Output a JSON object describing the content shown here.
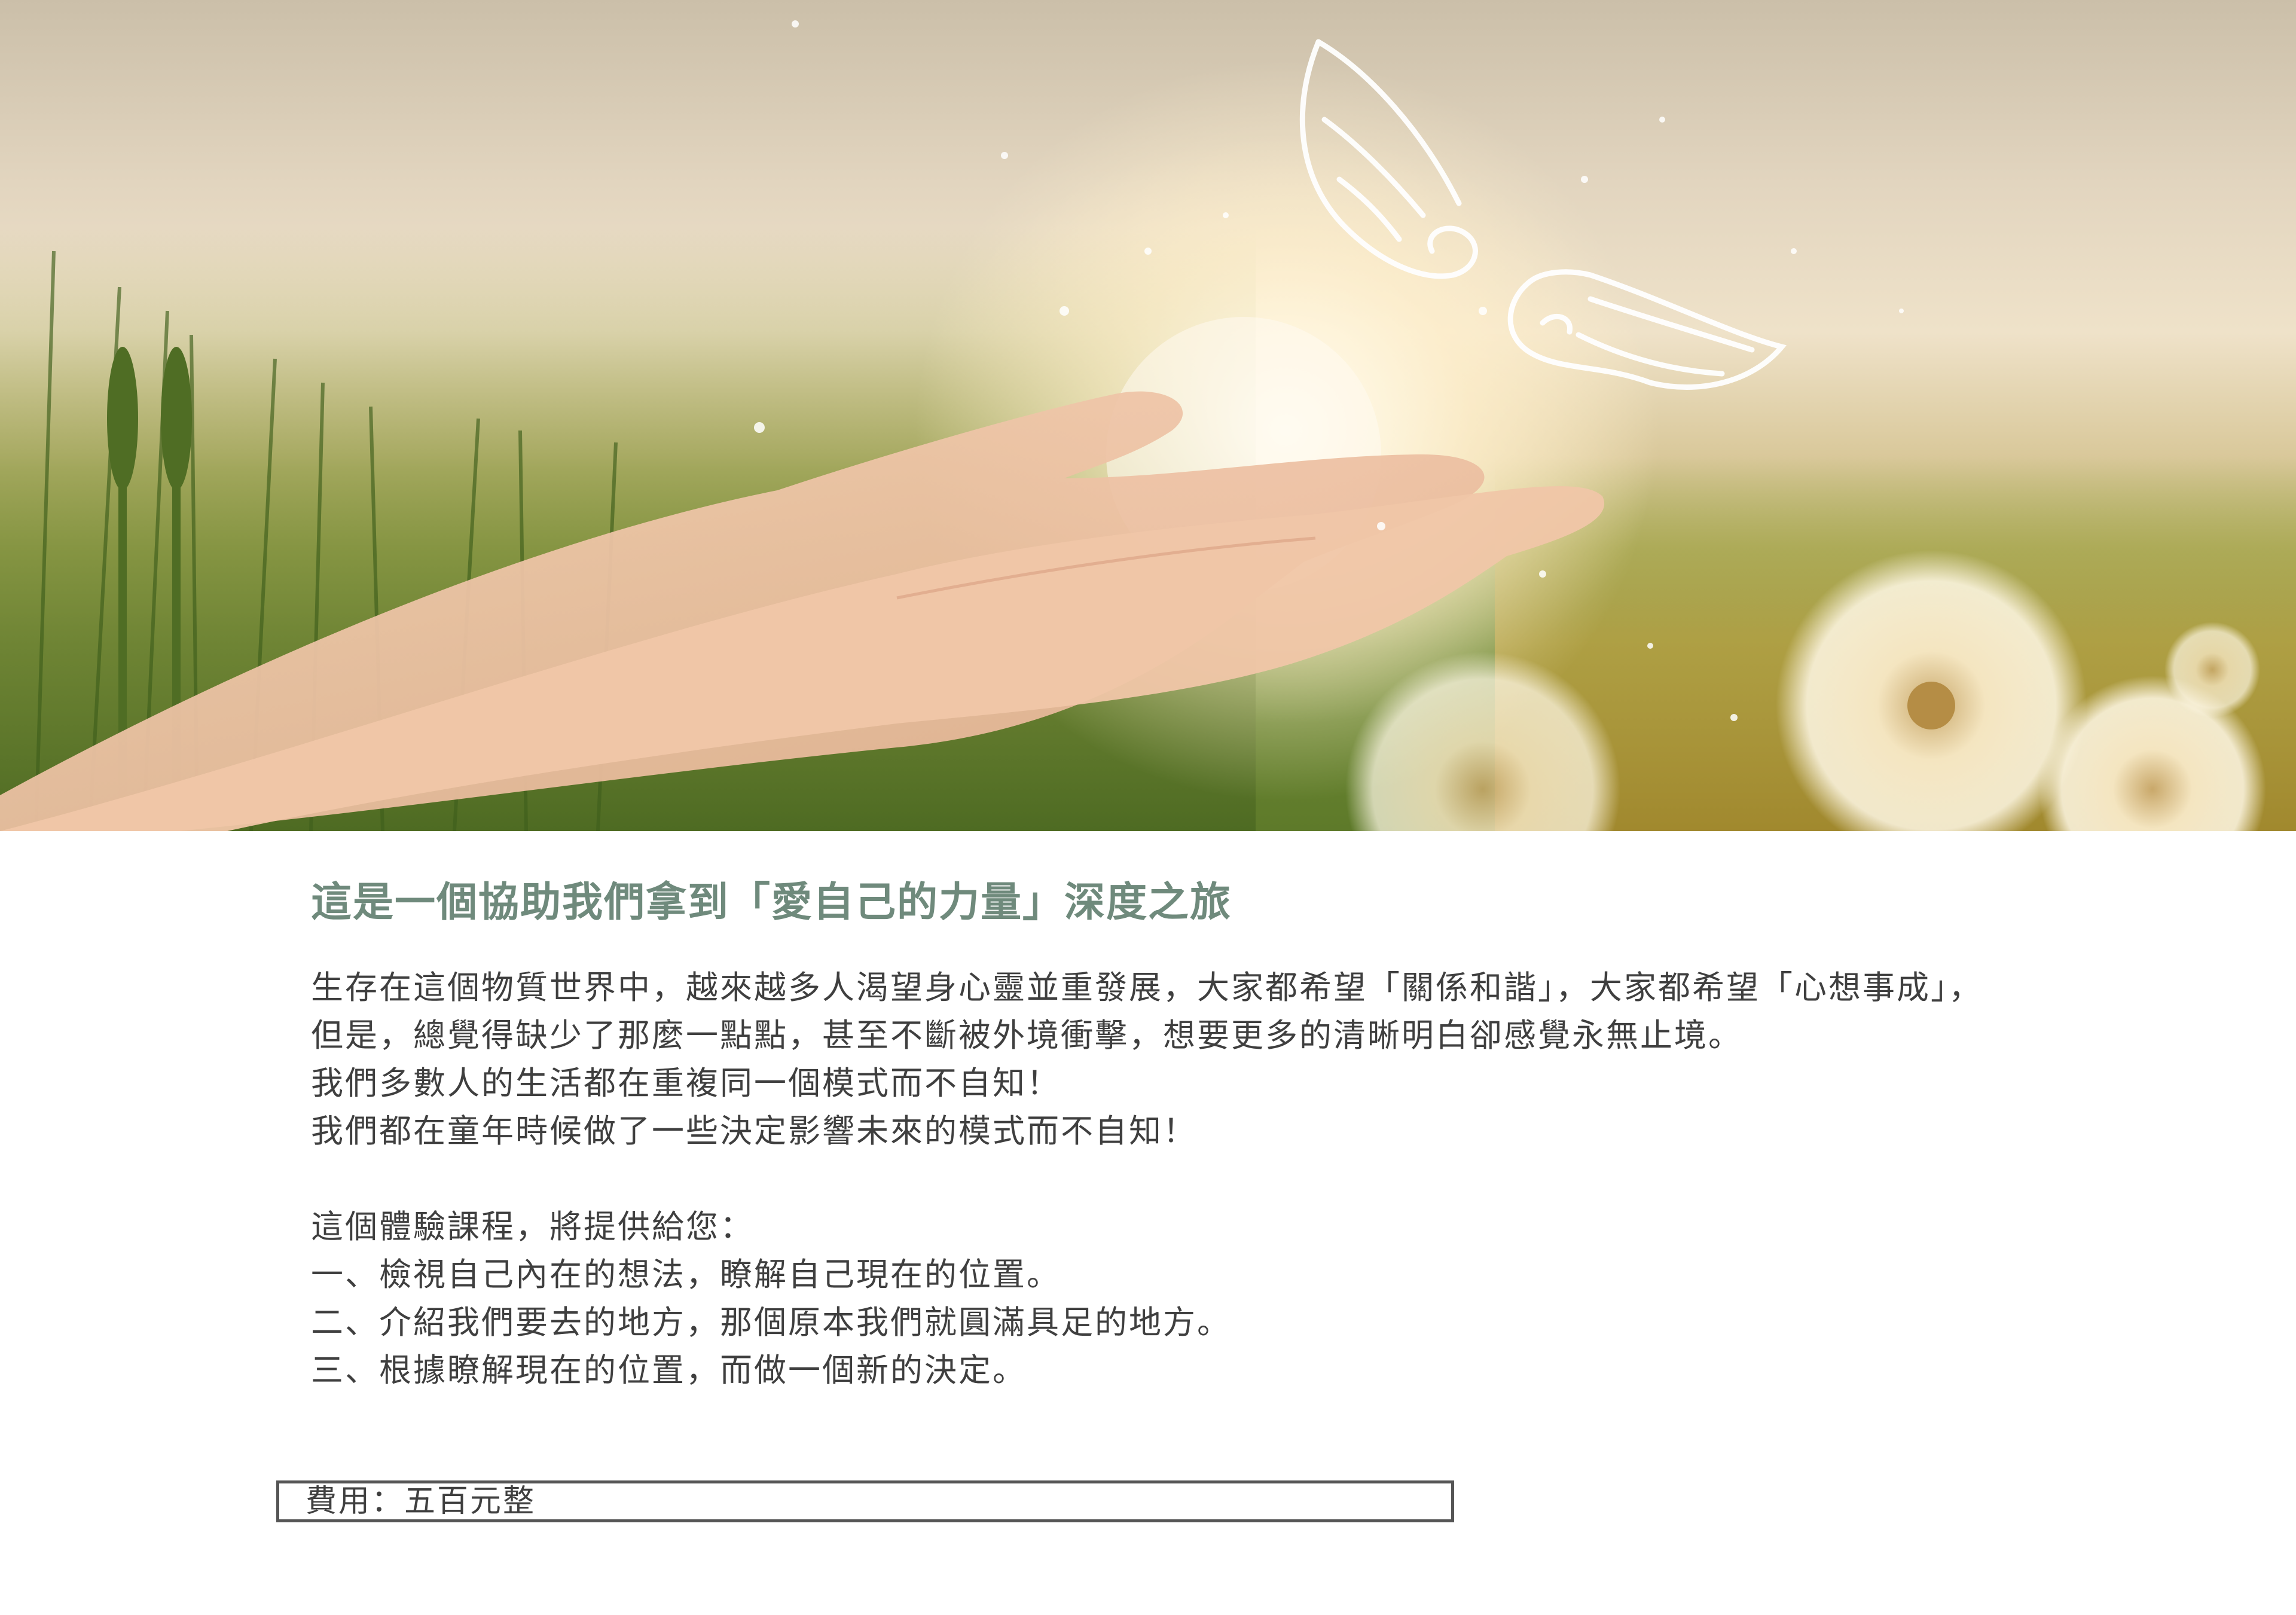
{
  "hero": {
    "image_description_icons": [
      "open-hands-icon",
      "angel-wings-icon",
      "dandelion-icon",
      "grass-field"
    ]
  },
  "headline": "這是一個協助我們拿到「愛自己的力量」深度之旅",
  "intro_lines": [
    "生存在這個物質世界中，越來越多人渴望身心靈並重發展，大家都希望「關係和諧」，大家都希望「心想事成」，",
    "但是，總覺得缺少了那麼一點點，甚至不斷被外境衝擊，想要更多的清晰明白卻感覺永無止境。",
    "我們多數人的生活都在重複同一個模式而不自知！",
    "我們都在童年時候做了一些決定影響未來的模式而不自知！"
  ],
  "offer_lines": [
    "這個體驗課程，將提供給您：",
    "一、檢視自己內在的想法，瞭解自己現在的位置。",
    "二、介紹我們要去的地方，那個原本我們就圓滿具足的地方。",
    "三、根據瞭解現在的位置，而做一個新的決定。"
  ],
  "fee": "費用：五百元整",
  "colors": {
    "headline": "#6f8a7c",
    "body_text": "#3f3f3f",
    "fee_border": "#555555"
  }
}
